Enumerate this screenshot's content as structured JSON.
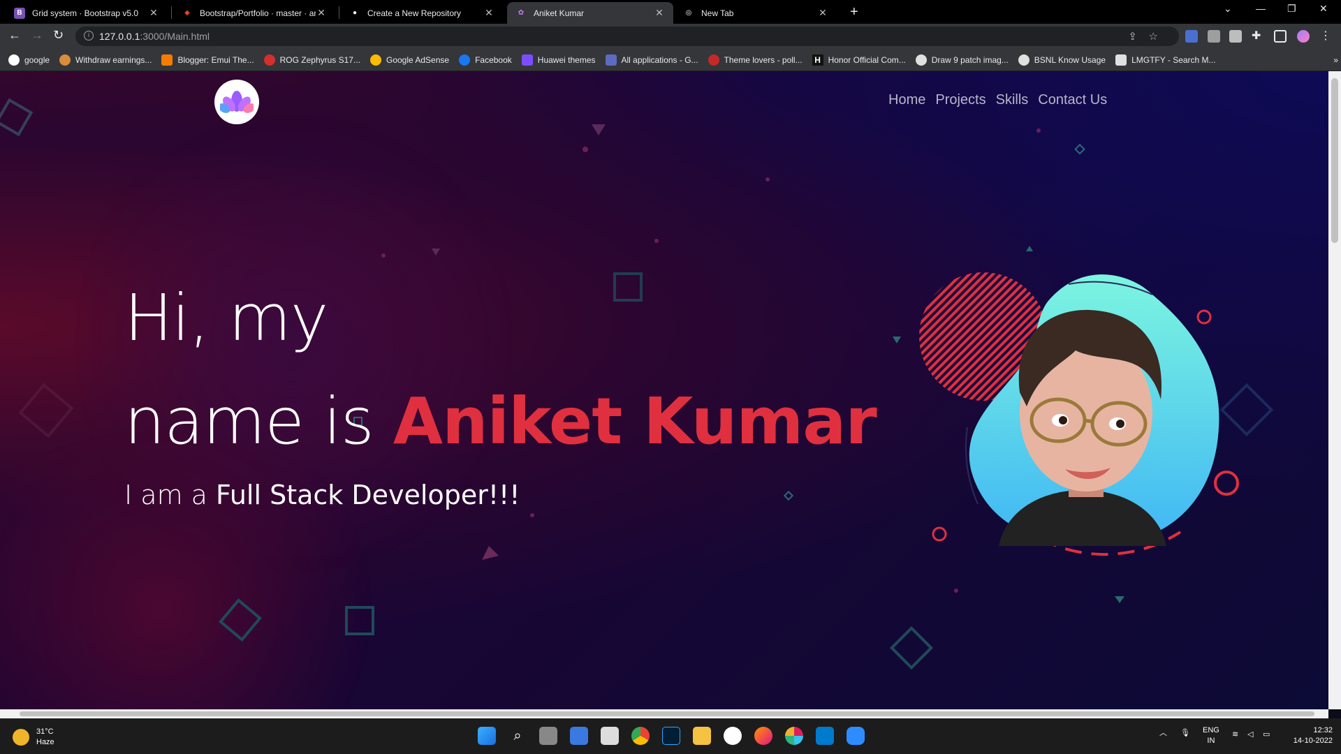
{
  "browser": {
    "tabs": [
      {
        "title": "Grid system · Bootstrap v5.0",
        "icon": "bootstrap-icon",
        "color": "#7952b3",
        "glyph": "B"
      },
      {
        "title": "Bootstrap/Portfolio · master · ani",
        "icon": "gitlab-icon",
        "color": "#e24329",
        "glyph": "◆"
      },
      {
        "title": "Create a New Repository",
        "icon": "github-icon",
        "color": "#ffffff",
        "glyph": "●"
      },
      {
        "title": "Aniket Kumar",
        "icon": "lotus-icon",
        "color": "#c77dff",
        "glyph": "✿"
      },
      {
        "title": "New Tab",
        "icon": "chrome-icon",
        "color": "#ffffff",
        "glyph": "◎"
      }
    ],
    "active_tab": 3,
    "new_tab": "+",
    "address": {
      "host": "127.0.0.1",
      "path": ":3000/Main.html"
    },
    "bookmarks": [
      {
        "label": "google",
        "color": "#ffffff"
      },
      {
        "label": "Withdraw earnings...",
        "color": "#d98c3a"
      },
      {
        "label": "Blogger: Emui The...",
        "color": "#f57c00"
      },
      {
        "label": "ROG Zephyrus S17...",
        "color": "#d32f2f"
      },
      {
        "label": "Google AdSense",
        "color": "#fbbc04"
      },
      {
        "label": "Facebook",
        "color": "#1877f2"
      },
      {
        "label": "Huawei themes",
        "color": "#7c4dff"
      },
      {
        "label": "All applications - G...",
        "color": "#5c6bc0"
      },
      {
        "label": "Theme lovers - poll...",
        "color": "#c62828"
      },
      {
        "label": "Honor Official Com...",
        "color": "#111111"
      },
      {
        "label": "Draw 9 patch imag...",
        "color": "#e0e0e0"
      },
      {
        "label": "BSNL Know Usage",
        "color": "#e0e0e0"
      },
      {
        "label": "LMGTFY - Search M...",
        "color": "#e0e0e0"
      }
    ]
  },
  "page": {
    "nav": [
      "Home",
      "Projects",
      "Skills",
      "Contact Us"
    ],
    "hero_line1": "Hi, my",
    "hero_line2_prefix": "name is ",
    "hero_name": "Aniket Kumar",
    "sub_prefix": "I am a ",
    "sub_role": "Full Stack Developer!!!",
    "accent": "#e0303f"
  },
  "taskbar": {
    "temperature": "31°C",
    "condition": "Haze",
    "language_top": "ENG",
    "language_bottom": "IN",
    "time": "12:32",
    "date": "14-10-2022"
  }
}
